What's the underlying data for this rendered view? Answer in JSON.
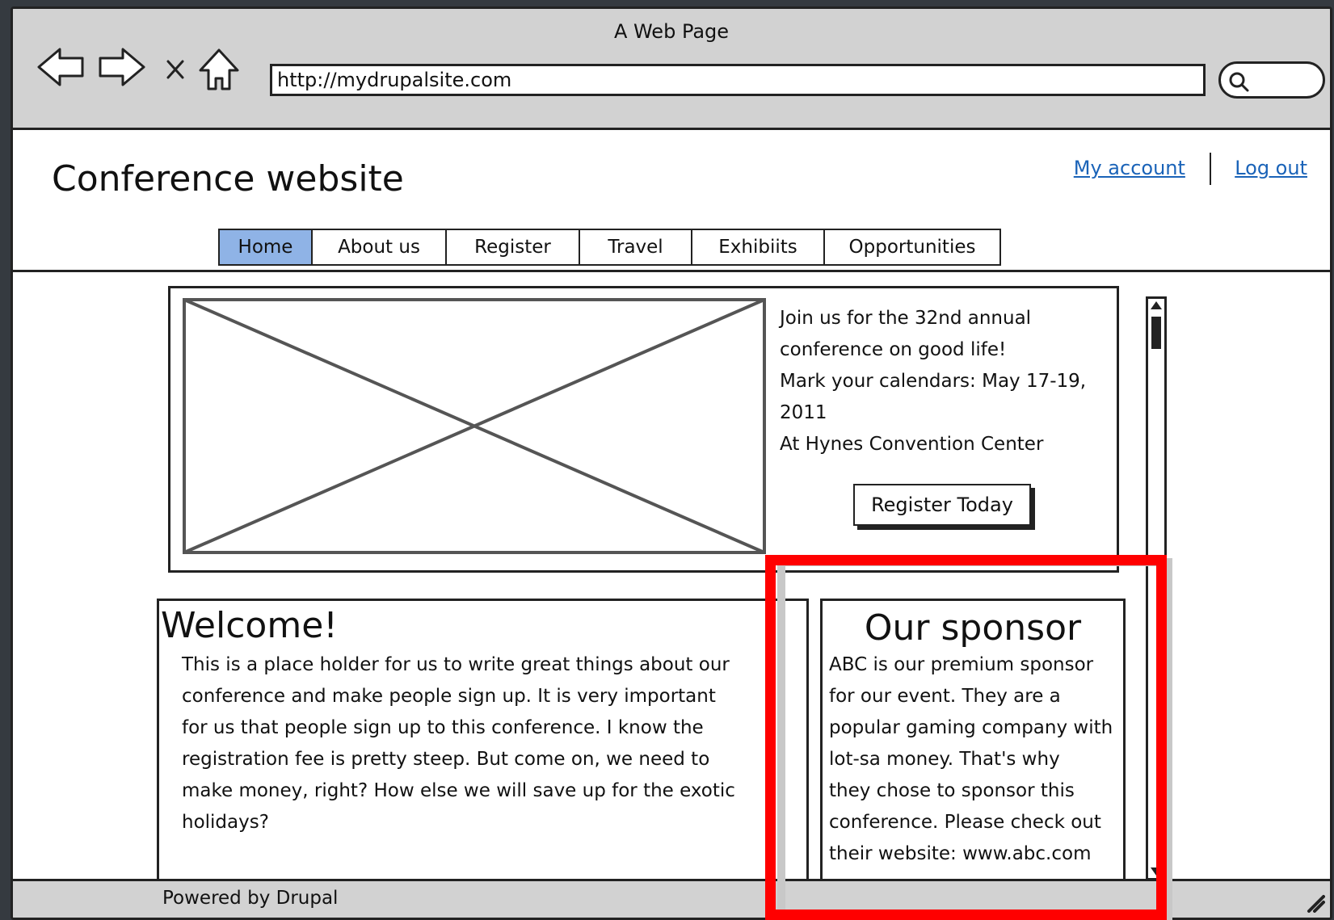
{
  "window": {
    "title": "A Web Page"
  },
  "browser": {
    "url": "http://mydrupalsite.com"
  },
  "site": {
    "title": "Conference website"
  },
  "user_links": {
    "account": "My account",
    "logout": "Log out"
  },
  "tabs": [
    "Home",
    "About us",
    "Register",
    "Travel",
    "Exhibiits",
    "Opportunities"
  ],
  "active_tab": "Home",
  "hero": {
    "lines": [
      "Join us for the 32nd annual",
      "conference on good life!",
      "Mark your calendars: May 17-19,",
      "2011",
      "At Hynes Convention Center"
    ],
    "button": "Register Today"
  },
  "welcome": {
    "heading": "Welcome!",
    "lines": [
      "This is a place holder for us to write great things about our",
      "conference and make people sign up. It is very important",
      "for us that people sign up to this conference. I know the",
      "registration fee is pretty steep. But come on, we need to",
      "make money, right? How else we will save up for the exotic",
      "holidays?"
    ]
  },
  "sponsor": {
    "heading": "Our sponsor",
    "lines": [
      "ABC is our premium sponsor",
      "for our event. They are a",
      "popular gaming company with",
      "lot-sa money. That's why",
      "they chose to sponsor this",
      "conference. Please check out",
      "their website: www.abc.com"
    ]
  },
  "footer": {
    "text": "Powered by Drupal"
  },
  "icons": [
    "back-arrow-icon",
    "forward-arrow-icon",
    "stop-icon",
    "home-icon",
    "search-icon",
    "image-placeholder-icon",
    "scroll-up-icon",
    "scroll-down-icon",
    "resize-grip-icon"
  ],
  "colors": {
    "active_tab": "#8fb3e6",
    "link": "#1a63b8",
    "highlight": "#ff0000",
    "chrome": "#d2d2d2"
  }
}
